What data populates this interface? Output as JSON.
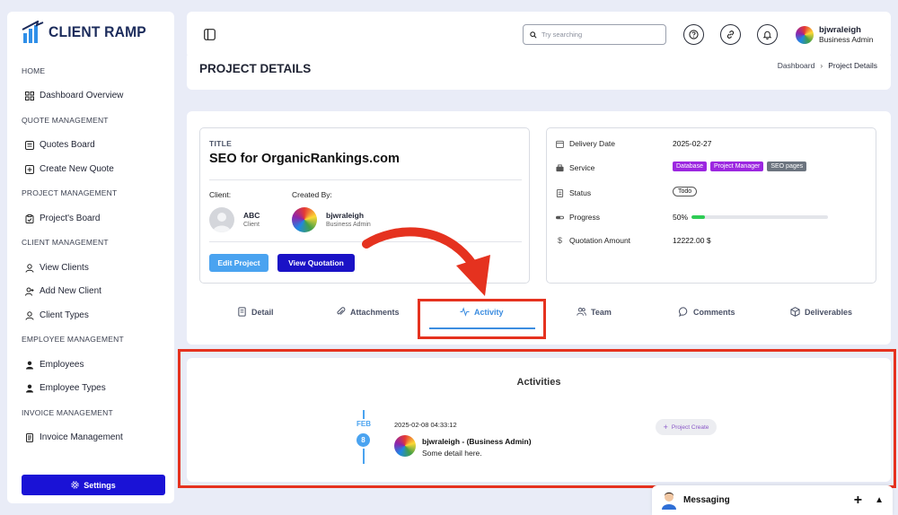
{
  "brand": {
    "name": "CLIENT RAMP"
  },
  "sidebar": {
    "sections": [
      {
        "title": "HOME",
        "items": [
          "Dashboard Overview"
        ]
      },
      {
        "title": "QUOTE MANAGEMENT",
        "items": [
          "Quotes Board",
          "Create New Quote"
        ]
      },
      {
        "title": "PROJECT MANAGEMENT",
        "items": [
          "Project's Board"
        ]
      },
      {
        "title": "CLIENT MANAGEMENT",
        "items": [
          "View Clients",
          "Add New Client",
          "Client Types"
        ]
      },
      {
        "title": "EMPLOYEE MANAGEMENT",
        "items": [
          "Employees",
          "Employee Types"
        ]
      },
      {
        "title": "INVOICE MANAGEMENT",
        "items": [
          "Invoice Management"
        ]
      }
    ],
    "settings_label": "Settings"
  },
  "header": {
    "search_placeholder": "Try searching",
    "user_name": "bjwraleigh",
    "user_role": "Business Admin"
  },
  "page": {
    "title": "PROJECT DETAILS",
    "breadcrumb": [
      "Dashboard",
      "Project Details"
    ]
  },
  "project": {
    "label": "TITLE",
    "title": "SEO for OrganicRankings.com",
    "client_label": "Client:",
    "created_by_label": "Created By:",
    "client_name": "ABC",
    "client_role": "Client",
    "creator_name": "bjwraleigh",
    "creator_role": "Business Admin",
    "edit_label": "Edit Project",
    "view_quote_label": "View Quotation"
  },
  "info": {
    "delivery_label": "Delivery Date",
    "delivery_value": "2025-02-27",
    "service_label": "Service",
    "services": [
      "Database",
      "Project Manager",
      "SEO pages"
    ],
    "status_label": "Status",
    "status_value": "Todo",
    "progress_label": "Progress",
    "progress_text": "50%",
    "progress_value": 50,
    "amount_label": "Quotation Amount",
    "amount_value": "12222.00 $"
  },
  "tabs": [
    "Detail",
    "Attachments",
    "Activity",
    "Team",
    "Comments",
    "Deliverables"
  ],
  "active_tab": "Activity",
  "activities": {
    "title": "Activities",
    "month": "FEB",
    "day": "8",
    "timestamp": "2025-02-08 04:33:12",
    "user": "bjwraleigh - (Business Admin)",
    "detail": "Some detail here.",
    "badge": "Project Create"
  },
  "messaging": {
    "label": "Messaging"
  },
  "colors": {
    "primary": "#1a12d6",
    "accent": "#4aa3f0",
    "annotation": "#e5321f",
    "progress": "#2ecc55"
  }
}
